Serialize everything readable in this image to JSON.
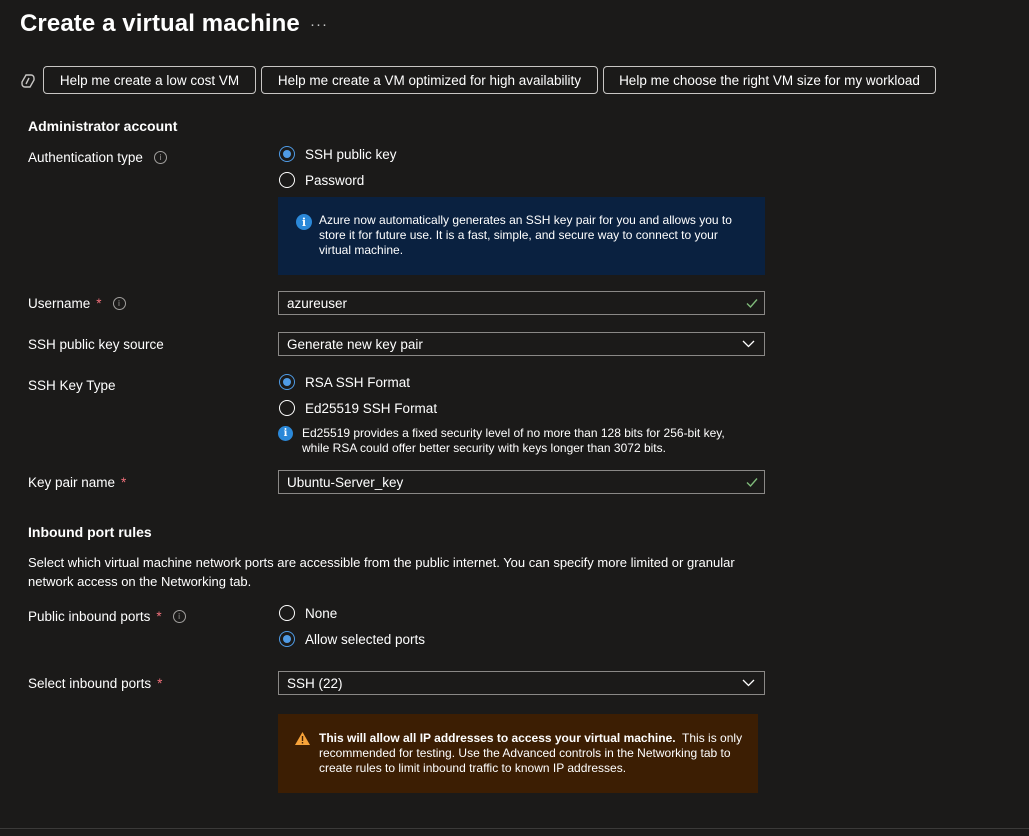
{
  "page": {
    "title": "Create a virtual machine",
    "more_label": "···"
  },
  "copilot_buttons": [
    {
      "label": "Help me create a low cost VM"
    },
    {
      "label": "Help me create a VM optimized for high availability"
    },
    {
      "label": "Help me choose the right VM size for my workload"
    }
  ],
  "admin": {
    "heading": "Administrator account",
    "auth_type": {
      "label": "Authentication type",
      "options": [
        "SSH public key",
        "Password"
      ],
      "selected": "SSH public key"
    },
    "auth_info": "Azure now automatically generates an SSH key pair for you and allows you to store it for future use. It is a fast, simple, and secure way to connect to your virtual machine.",
    "username": {
      "label": "Username",
      "required_mark": "*",
      "value": "azureuser"
    },
    "ssh_key_source": {
      "label": "SSH public key source",
      "value": "Generate new key pair"
    },
    "ssh_key_type": {
      "label": "SSH Key Type",
      "options": [
        "RSA SSH Format",
        "Ed25519 SSH Format"
      ],
      "selected": "RSA SSH Format",
      "info_line1": "Ed25519 provides a fixed security level of no more than 128 bits for 256-bit key,",
      "info_line2": "while RSA could offer better security with keys longer than 3072 bits."
    },
    "key_pair_name": {
      "label": "Key pair name",
      "required_mark": "*",
      "value": "Ubuntu-Server_key"
    }
  },
  "inbound": {
    "heading": "Inbound port rules",
    "description_line1": "Select which virtual machine network ports are accessible from the public internet. You can specify more limited or granular",
    "description_line2": "network access on the Networking tab.",
    "public_ports": {
      "label": "Public inbound ports",
      "required_mark": "*",
      "options": [
        "None",
        "Allow selected ports"
      ],
      "selected": "Allow selected ports"
    },
    "select_ports": {
      "label": "Select inbound ports",
      "required_mark": "*",
      "value": "SSH (22)"
    },
    "warning_bold": "This will allow all IP addresses to access your virtual machine.",
    "warning_text": "This is only recommended for testing.  Use the Advanced controls in the Networking tab to create rules to limit inbound traffic to known IP addresses."
  },
  "colors": {
    "background": "#1b1a19",
    "accent": "#4f9be5",
    "success": "#7fba7a",
    "required": "#f1707b",
    "info_bg": "#0a2140",
    "warning_bg": "#3c1e03",
    "warning_icon": "#f7a33a"
  }
}
